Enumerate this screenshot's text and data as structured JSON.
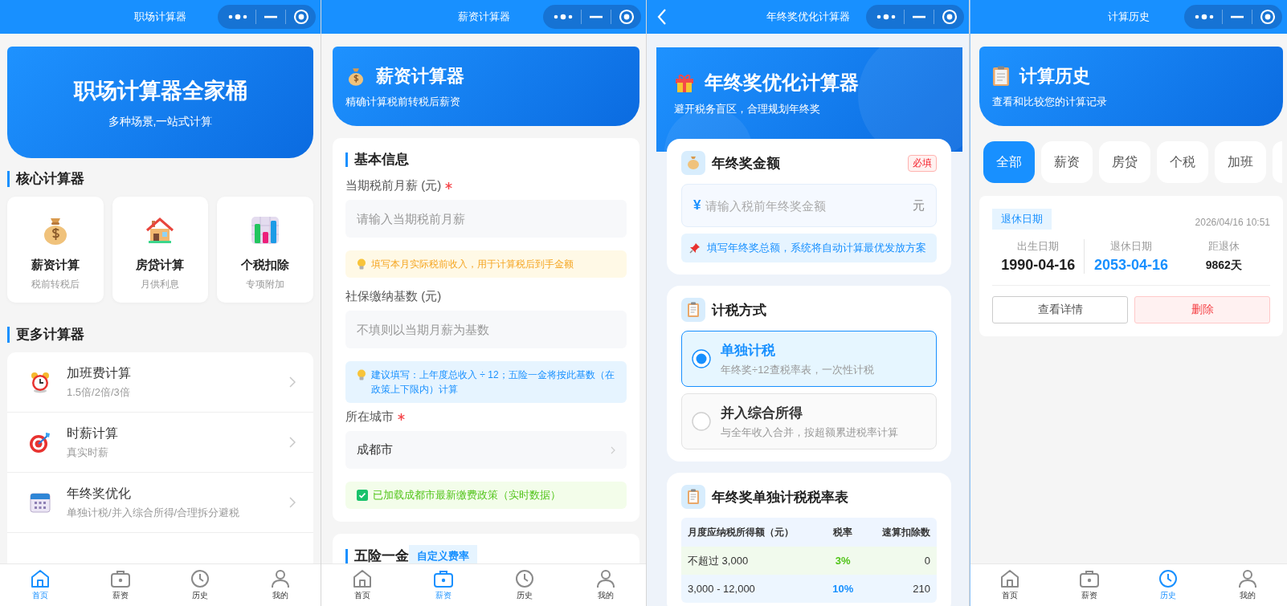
{
  "home": {
    "nav": {
      "title": "职场计算器"
    },
    "hero": {
      "title": "职场计算器全家桶",
      "subtitle": "多种场景,一站式计算"
    },
    "core": {
      "heading": "核心计算器",
      "items": [
        {
          "title": "薪资计算",
          "subtitle": "税前转税后"
        },
        {
          "title": "房贷计算",
          "subtitle": "月供利息"
        },
        {
          "title": "个税扣除",
          "subtitle": "专项附加"
        }
      ]
    },
    "more": {
      "heading": "更多计算器",
      "items": [
        {
          "title": "加班费计算",
          "subtitle": "1.5倍/2倍/3倍"
        },
        {
          "title": "时薪计算",
          "subtitle": "真实时薪"
        },
        {
          "title": "年终奖优化",
          "subtitle": "单独计税/并入综合所得/合理拆分避税"
        }
      ]
    },
    "tab_bar": [
      {
        "label": "首页",
        "selected": true
      },
      {
        "label": "薪资",
        "selected": false
      },
      {
        "label": "历史",
        "selected": false
      },
      {
        "label": "我的",
        "selected": false
      }
    ]
  },
  "salary": {
    "nav": {
      "title": "薪资计算器"
    },
    "hero": {
      "title": "薪资计算器",
      "subtitle": "精确计算税前转税后薪资"
    },
    "basic": {
      "heading": "基本信息",
      "fields": [
        {
          "label": "当期税前月薪 (元)",
          "required": true,
          "kind": "input",
          "placeholder": "请输入当期税前月薪",
          "tip": {
            "kind": "warning",
            "text": "填写本月实际税前收入，用于计算税后到手金额"
          }
        },
        {
          "label": "社保缴纳基数 (元)",
          "required": false,
          "kind": "input",
          "placeholder": "不填则以当期月薪为基数",
          "tip": {
            "kind": "info",
            "text": "建议填写：上年度总收入 ÷ 12；五险一金将按此基数（在政策上下限内）计算"
          }
        },
        {
          "label": "所在城市",
          "required": true,
          "kind": "select",
          "value": "成都市",
          "tip": {
            "kind": "success",
            "text": "已加载成都市最新缴费政策（实时数据）"
          }
        }
      ]
    },
    "insurance": {
      "heading": "五险一金",
      "badge": "自定义费率"
    },
    "tab_bar": [
      {
        "label": "首页",
        "selected": false
      },
      {
        "label": "薪资",
        "selected": true
      },
      {
        "label": "历史",
        "selected": false
      },
      {
        "label": "我的",
        "selected": false
      }
    ]
  },
  "bonus": {
    "nav": {
      "title": "年终奖优化计算器",
      "back": true
    },
    "hero": {
      "title": "年终奖优化计算器",
      "subtitle": "避开税务盲区，合理规划年终奖"
    },
    "amount": {
      "heading": "年终奖金额",
      "badge": "必填",
      "currency": "¥",
      "placeholder": "请输入税前年终奖金额",
      "unit": "元",
      "tip": "填写年终奖总额，系统将自动计算最优发放方案"
    },
    "method": {
      "heading": "计税方式",
      "options": [
        {
          "title": "单独计税",
          "desc": "年终奖÷12查税率表，一次性计税",
          "selected": true
        },
        {
          "title": "并入综合所得",
          "desc": "与全年收入合并，按超额累进税率计算",
          "selected": false
        }
      ]
    },
    "rate_table": {
      "heading": "年终奖单独计税税率表",
      "columns": [
        "月度应纳税所得额（元）",
        "税率",
        "速算扣除数"
      ],
      "rows": [
        {
          "cells": [
            "不超过 3,000",
            "3%",
            "0"
          ],
          "color": "#52c41a"
        },
        {
          "cells": [
            "3,000 - 12,000",
            "10%",
            "210"
          ],
          "color": "#1890ff"
        }
      ]
    }
  },
  "history": {
    "nav": {
      "title": "计算历史"
    },
    "hero": {
      "title": "计算历史",
      "subtitle": "查看和比较您的计算记录"
    },
    "filters": [
      {
        "label": "全部",
        "selected": true
      },
      {
        "label": "薪资",
        "selected": false
      },
      {
        "label": "房贷",
        "selected": false
      },
      {
        "label": "个税",
        "selected": false
      },
      {
        "label": "加班",
        "selected": false
      }
    ],
    "record": {
      "tag": "退休日期",
      "time": "2026/04/16 10:51",
      "stats": [
        {
          "label": "出生日期",
          "value": "1990-04-16",
          "kind": "date"
        },
        {
          "label": "退休日期",
          "value": "2053-04-16",
          "kind": "highlight"
        },
        {
          "label": "距退休",
          "value": "9862天",
          "kind": "count"
        }
      ],
      "buttons": [
        {
          "label": "查看详情",
          "kind": "default"
        },
        {
          "label": "删除",
          "kind": "danger"
        }
      ]
    },
    "tab_bar": [
      {
        "label": "首页",
        "selected": false
      },
      {
        "label": "薪资",
        "selected": false
      },
      {
        "label": "历史",
        "selected": true
      },
      {
        "label": "我的",
        "selected": false
      }
    ]
  }
}
